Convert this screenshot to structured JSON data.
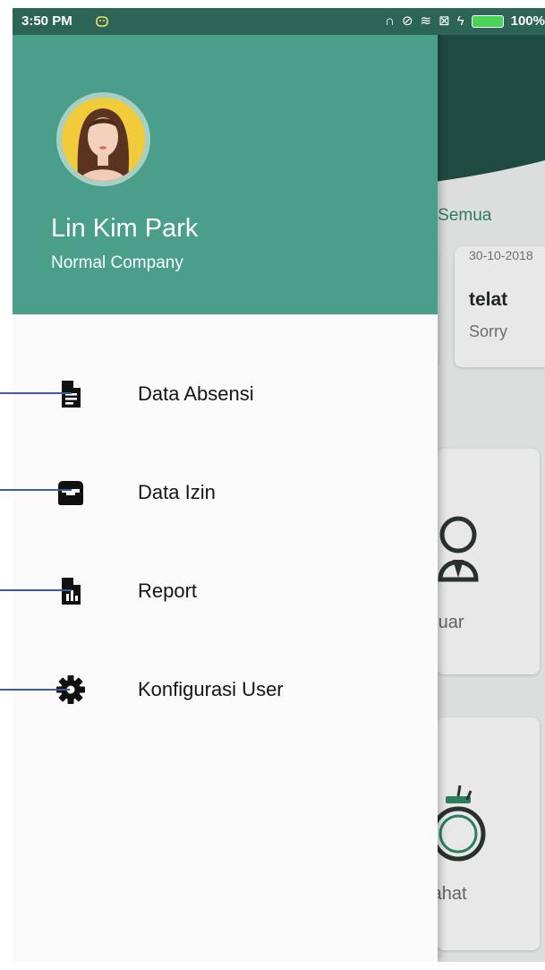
{
  "status_bar": {
    "time": "3:50 PM",
    "battery": "100%",
    "icons": [
      "android-icon",
      "headphones-icon",
      "mute-icon",
      "wifi-icon",
      "sim-icon",
      "charging-icon",
      "battery-icon"
    ]
  },
  "background": {
    "see_all": "at Semua",
    "card_date": "30-10-2018",
    "card_title": "telat",
    "card_note": "Sorry",
    "tile_keluar": "eluar",
    "tile_istirahat": "rahat"
  },
  "drawer": {
    "user_name": "Lin Kim Park",
    "company": "Normal Company",
    "menu": [
      {
        "label": "Data Absensi",
        "icon": "document-icon"
      },
      {
        "label": "Data Izin",
        "icon": "inbox-icon"
      },
      {
        "label": "Report",
        "icon": "report-icon"
      },
      {
        "label": "Konfigurasi User",
        "icon": "gear-icon"
      }
    ]
  },
  "colors": {
    "status_bar": "#2c6457",
    "drawer_header": "#4a9f8a",
    "drawer_body": "#fafafa",
    "pointer_line": "#3d5a9e"
  }
}
